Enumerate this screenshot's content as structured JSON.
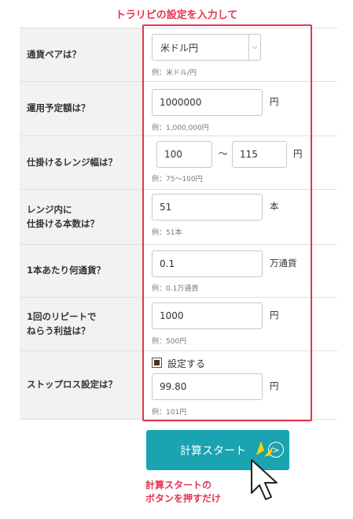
{
  "annotation_top": "トラリピの設定を入力して",
  "rows": {
    "pair": {
      "label": "通貨ペアは？",
      "selected": "米ドル円",
      "example": "例：米ドル/円"
    },
    "budget": {
      "label": "運用予定額は？",
      "value": "1000000",
      "unit": "円",
      "example": "例：1,000,000円"
    },
    "range": {
      "label": "仕掛けるレンジ幅は？",
      "from": "100",
      "separator": "〜",
      "to": "115",
      "unit": "円",
      "example": "例：75〜100円"
    },
    "count": {
      "label_line1": "レンジ内に",
      "label_line2": "仕掛ける本数は？",
      "value": "51",
      "unit": "本",
      "example": "例：51本"
    },
    "amount": {
      "label": "1本あたり何通貨？",
      "value": "0.1",
      "unit": "万通貨",
      "example": "例：0.1万通貨"
    },
    "profit": {
      "label_line1": "1回のリピートで",
      "label_line2": "ねらう利益は？",
      "value": "1000",
      "unit": "円",
      "example": "例：500円"
    },
    "stoploss": {
      "label": "ストップロス設定は？",
      "checkbox_label": "設定する",
      "checked": true,
      "value": "99.80",
      "unit": "円",
      "example": "例：101円"
    }
  },
  "button": {
    "label": "計算スタート"
  },
  "annotation_bottom": {
    "line1": "計算スタートの",
    "line2": "ボタンを押すだけ"
  },
  "colors": {
    "accent_red": "#e8344e",
    "button_teal": "#1aa3b0",
    "label_bg": "#f2f2f2"
  },
  "icons": {
    "select_arrow": "chevron-down-icon",
    "button_arrow": "circle-chevron-right-icon",
    "cursor": "mouse-pointer-icon"
  }
}
